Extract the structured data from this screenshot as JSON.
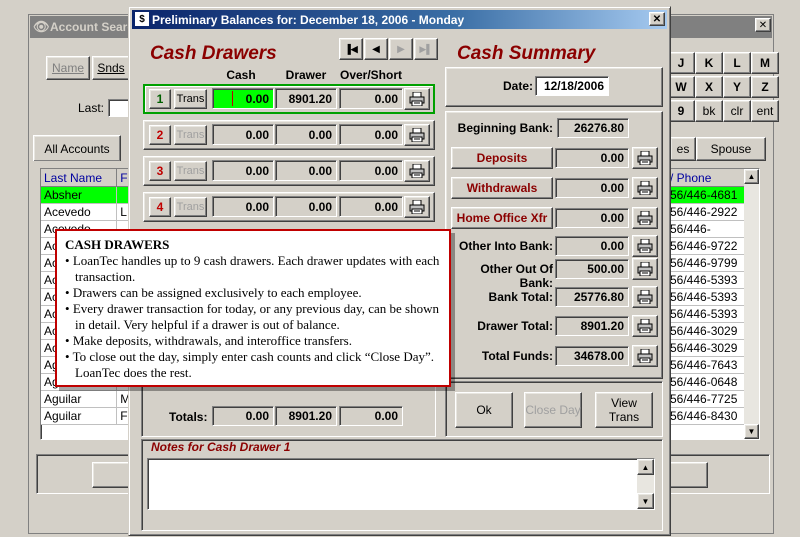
{
  "background_window": {
    "title": "Account Search",
    "name_tab": "Name",
    "snds_tab": "Snds",
    "last_label": "Last:",
    "all_accounts_tab": "All Accounts",
    "es_tab": "es",
    "spouse_tab": "Spouse",
    "grid_header_last": "Last Name",
    "grid_header_f": "F",
    "grid_header_phone": "/ Phone",
    "rows": [
      {
        "last": "Absher",
        "first": "",
        "phone": "56/446-4681",
        "selected": true
      },
      {
        "last": "Acevedo",
        "first": "L",
        "phone": "56/446-2922",
        "selected": false
      },
      {
        "last": "Acevedo",
        "first": "",
        "phone": "56/446-",
        "selected": false
      },
      {
        "last": "Ac",
        "first": "",
        "phone": "56/446-9722",
        "selected": false
      },
      {
        "last": "Ac",
        "first": "",
        "phone": "56/446-9799",
        "selected": false
      },
      {
        "last": "Ac",
        "first": "",
        "phone": "56/446-5393",
        "selected": false
      },
      {
        "last": "Ac",
        "first": "",
        "phone": "56/446-5393",
        "selected": false
      },
      {
        "last": "Ac",
        "first": "",
        "phone": "56/446-5393",
        "selected": false
      },
      {
        "last": "Ac",
        "first": "",
        "phone": "56/446-3029",
        "selected": false
      },
      {
        "last": "Ac",
        "first": "",
        "phone": "56/446-3029",
        "selected": false
      },
      {
        "last": "Ag",
        "first": "",
        "phone": "56/446-7643",
        "selected": false
      },
      {
        "last": "Aguilar",
        "first": "",
        "phone": "56/446-0648",
        "selected": false
      },
      {
        "last": "Aguilar",
        "first": "M",
        "phone": "56/446-7725",
        "selected": false
      },
      {
        "last": "Aguilar",
        "first": "F",
        "phone": "56/446-8430",
        "selected": false
      }
    ],
    "keys": [
      "J",
      "K",
      "L",
      "M",
      "W",
      "X",
      "Y",
      "Z",
      "9",
      "bk",
      "clr",
      "ent"
    ]
  },
  "dialog": {
    "title": "Preliminary Balances for: December 18, 2006 - Monday",
    "close_glyph": "✕",
    "cash_drawers_title": "Cash Drawers",
    "col_cash": "Cash",
    "col_drawer": "Drawer",
    "col_overshort": "Over/Short",
    "drawers": [
      {
        "no": "1",
        "trans": "Trans",
        "cash": "0.00",
        "drawer": "8901.20",
        "overshort": "0.00",
        "active": true
      },
      {
        "no": "2",
        "trans": "Trans",
        "cash": "0.00",
        "drawer": "0.00",
        "overshort": "0.00",
        "active": false
      },
      {
        "no": "3",
        "trans": "Trans",
        "cash": "0.00",
        "drawer": "0.00",
        "overshort": "0.00",
        "active": false
      },
      {
        "no": "4",
        "trans": "Trans",
        "cash": "0.00",
        "drawer": "0.00",
        "overshort": "0.00",
        "active": false
      }
    ],
    "totals_label": "Totals:",
    "totals": {
      "cash": "0.00",
      "drawer": "8901.20",
      "overshort": "0.00"
    },
    "cash_summary_title": "Cash Summary",
    "date_label": "Date:",
    "date_value": "12/18/2006",
    "summary": {
      "beginning_bank_label": "Beginning Bank:",
      "beginning_bank": "26276.80",
      "deposits_label": "Deposits",
      "deposits": "0.00",
      "withdrawals_label": "Withdrawals",
      "withdrawals": "0.00",
      "home_office_label": "Home Office Xfr",
      "home_office": "0.00",
      "other_into_label": "Other Into Bank:",
      "other_into": "0.00",
      "other_out_label": "Other Out Of Bank:",
      "other_out": "500.00",
      "bank_total_label": "Bank Total:",
      "bank_total": "25776.80",
      "drawer_total_label": "Drawer Total:",
      "drawer_total": "8901.20",
      "total_funds_label": "Total Funds:",
      "total_funds": "34678.00"
    },
    "ok_label": "Ok",
    "close_day_label": "Close Day",
    "view_trans_label": "View Trans",
    "notes_title": "Notes for Cash Drawer 1",
    "notes_value": ""
  },
  "callout": {
    "heading": "CASH DRAWERS",
    "items": [
      "LoanTec handles up to 9 cash drawers. Each drawer updates with each transaction.",
      "Drawers can be assigned exclusively to each employee.",
      "Every drawer transaction for today, or any previous day, can be shown in detail. Very helpful if a drawer is out of balance.",
      "Make deposits, withdrawals, and interoffice transfers.",
      "To close out the day, simply enter cash counts and click “Close Day”. LoanTec does the rest."
    ]
  },
  "colors": {
    "accent_red": "#8b0000",
    "active_green": "#00cc00",
    "selected_row": "#00ff00",
    "title_blue": "#0a246a"
  }
}
